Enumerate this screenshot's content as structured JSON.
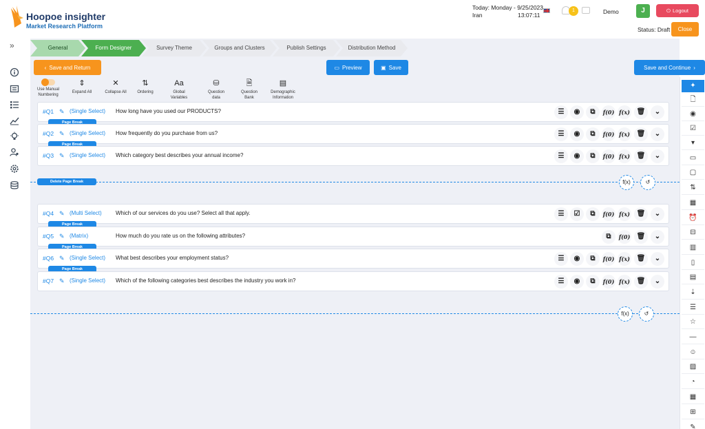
{
  "header": {
    "brand_title": "Hoopoe insighter",
    "brand_subtitle": "Market Research Platform",
    "date": "Today: Monday - 9/25/2023",
    "country": "Iran",
    "time": "13:07:11",
    "notification_count": "1",
    "user_name": "Demo",
    "avatar_letter": "J",
    "logout_label": "Logout",
    "status_text": "Status: Draft",
    "close_label": "Close"
  },
  "steps": [
    {
      "label": "General",
      "state": "done"
    },
    {
      "label": "Form Designer",
      "state": "active"
    },
    {
      "label": "Survey Theme",
      "state": "todo"
    },
    {
      "label": "Groups and Clusters",
      "state": "todo"
    },
    {
      "label": "Publish Settings",
      "state": "todo"
    },
    {
      "label": "Distribution Method",
      "state": "todo"
    }
  ],
  "actions": {
    "save_return": "Save and Return",
    "preview": "Preview",
    "save": "Save",
    "save_continue": "Save and Continue"
  },
  "toolbar": {
    "manual_numbering": "Use Manual Numbering",
    "expand_all": "Expand All",
    "collapse_all": "Collapse All",
    "ordering": "Ordering",
    "global_variables": "Global Variables",
    "question_data": "Question data",
    "question_bank": "Question Bank",
    "demographic_information": "Demographic Information"
  },
  "questions": [
    {
      "num": "#Q1",
      "type": "(Single Select)",
      "text": "How long have you used our PRODUCTS?"
    },
    {
      "num": "#Q2",
      "type": "(Single Select)",
      "text": "How frequently do you purchase from us?"
    },
    {
      "num": "#Q3",
      "type": "(Single Select)",
      "text": "Which category best describes your annual income?"
    },
    {
      "num": "#Q4",
      "type": "(Multi Select)",
      "text": "Which of our services do you use? Select all that apply."
    },
    {
      "num": "#Q5",
      "type": "(Matrix)",
      "text": "How much do you rate us on the following attributes?"
    },
    {
      "num": "#Q6",
      "type": "(Single Select)",
      "text": "What best describes your employment status?"
    },
    {
      "num": "#Q7",
      "type": "(Single Select)",
      "text": "Which of the following categories best describes the industry you work in?"
    }
  ],
  "page_break_label": "Page Break",
  "delete_page_break_label": "Delete Page Break",
  "icons": {
    "list": "☰",
    "radio": "◉",
    "checkbox": "☑",
    "copy": "⧉",
    "fx0": "f(0)",
    "fx": "f(x)",
    "trash": "🗑",
    "chevron": "⌄",
    "undo": "↺"
  }
}
